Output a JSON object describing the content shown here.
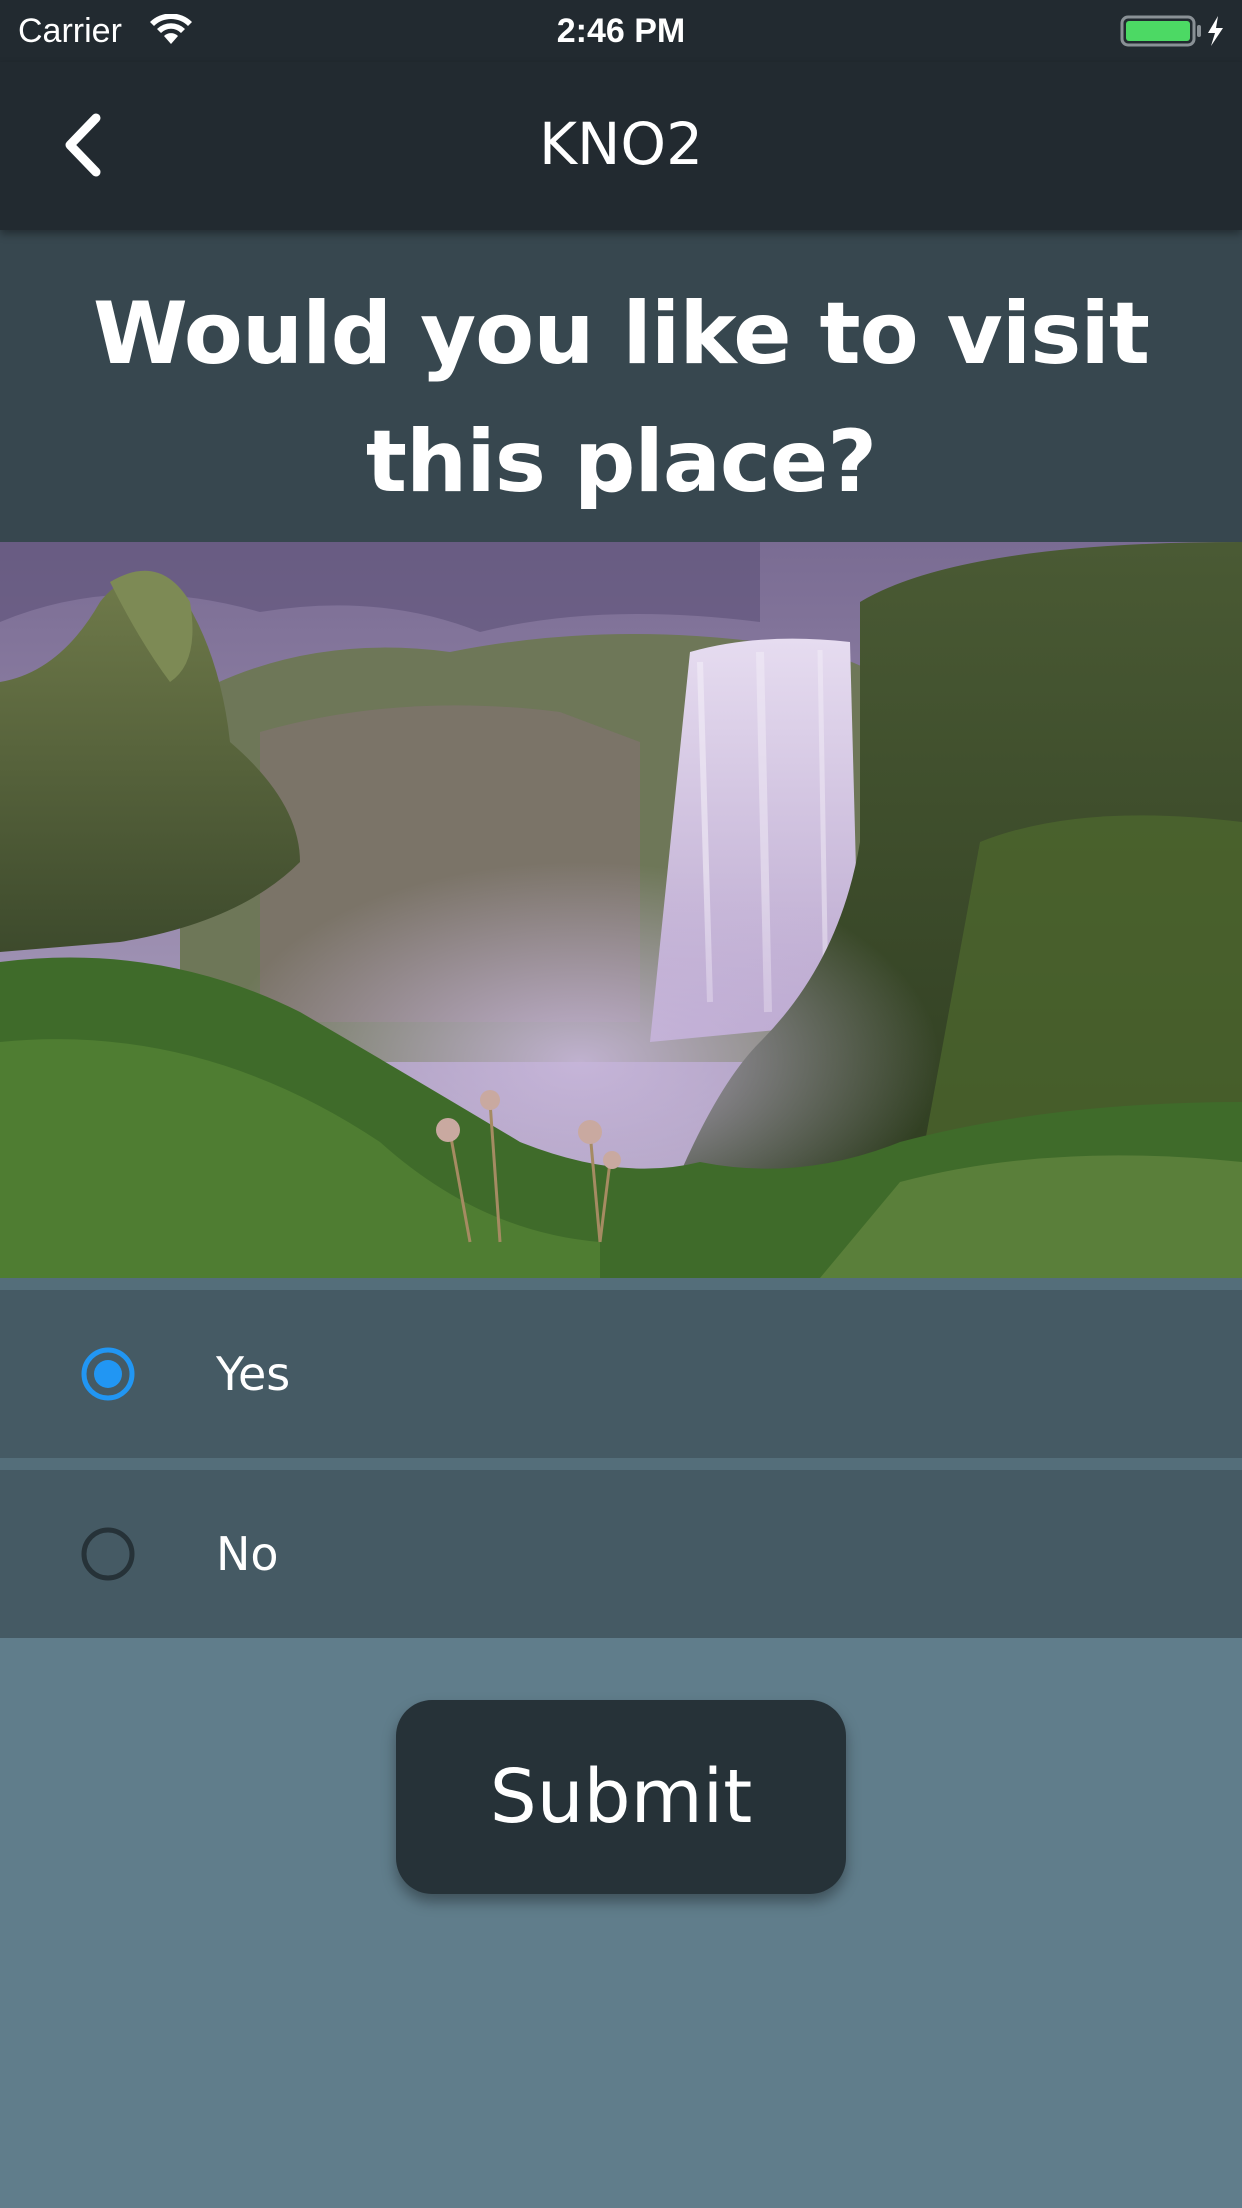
{
  "status_bar": {
    "carrier": "Carrier",
    "time": "2:46 PM",
    "wifi_icon": "wifi-icon",
    "battery_icon": "battery-charging-icon",
    "battery_level": 1.0
  },
  "nav": {
    "title": "KNO2",
    "back_icon": "chevron-left-icon"
  },
  "question": {
    "text": "Would you like to visit this place?"
  },
  "options": [
    {
      "label": "Yes",
      "selected": true
    },
    {
      "label": "No",
      "selected": false
    }
  ],
  "submit": {
    "label": "Submit"
  },
  "colors": {
    "nav_background": "#222a30",
    "question_background": "#37474f",
    "option_background": "#455a64",
    "page_background": "#607d8b",
    "submit_background": "#263238",
    "radio_selected": "#2196f3",
    "battery": "#4cd964"
  }
}
